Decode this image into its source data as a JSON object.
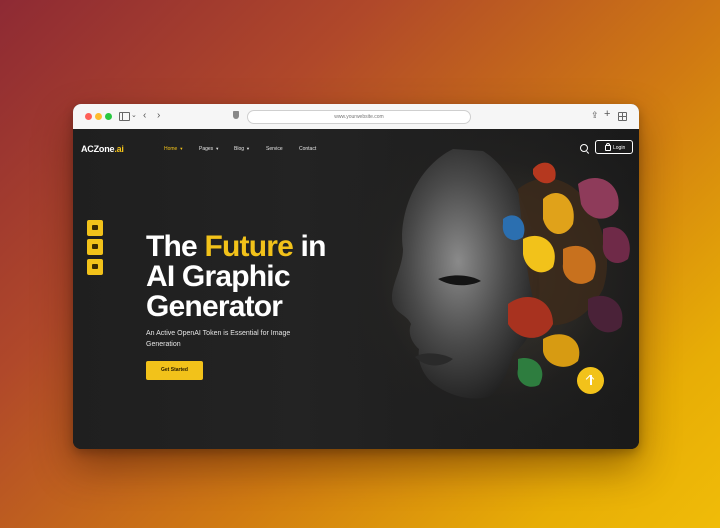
{
  "browser": {
    "url": "www.yourwebsite.com"
  },
  "site": {
    "logo": {
      "main": "ACZone",
      "accent": ".ai"
    },
    "nav": [
      {
        "label": "Home",
        "has_dropdown": true,
        "active": true
      },
      {
        "label": "Pages",
        "has_dropdown": true,
        "active": false
      },
      {
        "label": "Blog",
        "has_dropdown": true,
        "active": false
      },
      {
        "label": "Service",
        "has_dropdown": false,
        "active": false
      },
      {
        "label": "Contact",
        "has_dropdown": false,
        "active": false
      }
    ],
    "login_label": "Login",
    "hero": {
      "title_line1_a": "The ",
      "title_line1_accent": "Future",
      "title_line1_b": " in",
      "title_line2": "AI Graphic",
      "title_line3": "Generator",
      "subtitle": "An Active OpenAI Token is Essential for Image Generation",
      "cta_label": "Get Started"
    },
    "side_buttons": [
      "cart-icon",
      "bag-icon",
      "folder-icon"
    ]
  },
  "colors": {
    "accent": "#f2c21a",
    "dark_bg": "#1f1f1f"
  },
  "icons": [
    "search-icon",
    "lock-icon",
    "arrow-up-icon",
    "sidebar-toggle-icon",
    "shield-icon",
    "share-icon",
    "plus-icon",
    "grid-icon"
  ]
}
